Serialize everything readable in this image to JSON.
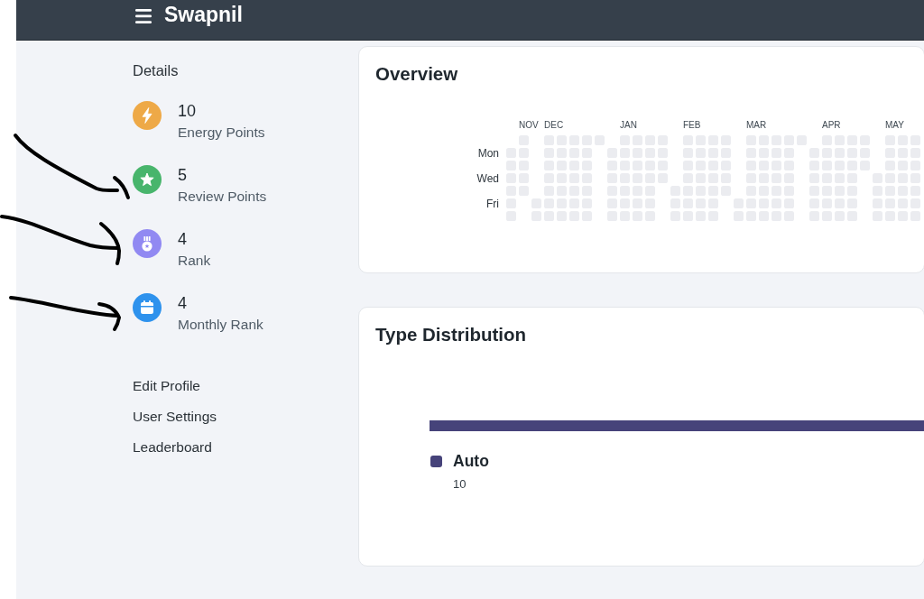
{
  "header": {
    "title": "Swapnil"
  },
  "sidebar": {
    "heading": "Details",
    "stats": [
      {
        "kind": "energy",
        "color": "#eea947",
        "value": "10",
        "label": "Energy Points"
      },
      {
        "kind": "review",
        "color": "#48b56c",
        "value": "5",
        "label": "Review Points"
      },
      {
        "kind": "rank",
        "color": "#9189f2",
        "value": "4",
        "label": "Rank"
      },
      {
        "kind": "monthly",
        "color": "#2e92ed",
        "value": "4",
        "label": "Monthly Rank"
      }
    ],
    "links": [
      "Edit Profile",
      "User Settings",
      "Leaderboard"
    ]
  },
  "overview": {
    "title": "Overview",
    "heatmap": {
      "months": [
        "NOV",
        "DEC",
        "JAN",
        "FEB",
        "MAR",
        "APR",
        "MAY"
      ],
      "days": [
        "Mon",
        "Wed",
        "Fri"
      ]
    }
  },
  "type_distribution": {
    "title": "Type Distribution",
    "segments": [
      {
        "label": "Auto",
        "value": "10",
        "color": "#46437a"
      }
    ]
  }
}
